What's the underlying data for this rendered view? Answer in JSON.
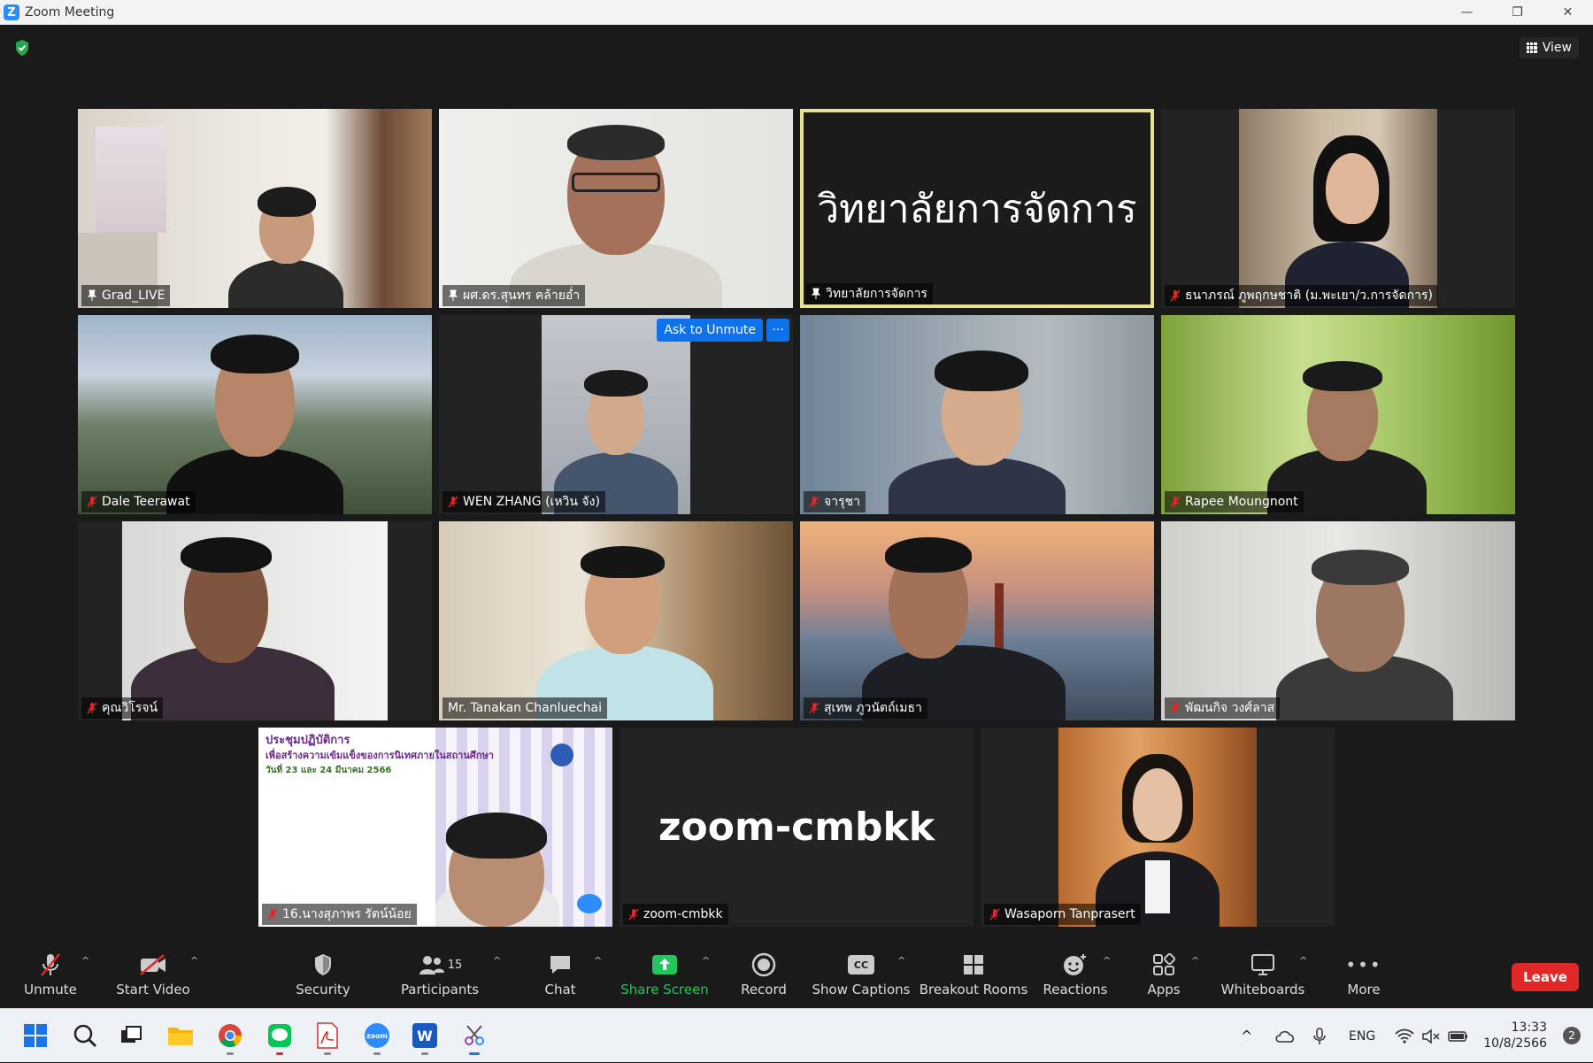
{
  "window": {
    "title": "Zoom Meeting",
    "minimize": "—",
    "restore": "❐",
    "close": "✕"
  },
  "header": {
    "view_label": "View"
  },
  "tiles": [
    {
      "name": "Grad_LIVE",
      "indicator": "pin"
    },
    {
      "name": "ผศ.ดร.สุนทร คล้ายอ่ำ",
      "indicator": "pin"
    },
    {
      "name": "วิทยาลัยการจัดการ",
      "indicator": "pin",
      "big_text": "วิทยาลัยการจัดการ",
      "active": true
    },
    {
      "name": "ธนาภรณ์ ภูพฤกษชาติ (ม.พะเยา/ว.การจัดการ)",
      "indicator": "mic-off"
    },
    {
      "name": "Dale Teerawat",
      "indicator": "mic-off"
    },
    {
      "name": "WEN ZHANG (เหวิน จัง)",
      "indicator": "mic-off",
      "ask_unmute": "Ask to Unmute",
      "more": "···"
    },
    {
      "name": "จารุชา",
      "indicator": "mic-off"
    },
    {
      "name": "Rapee Moungnont",
      "indicator": "mic-off"
    },
    {
      "name": "คุณวิโรจน์",
      "indicator": "mic-off"
    },
    {
      "name": "Mr. Tanakan Chanluechai",
      "indicator": "none"
    },
    {
      "name": "สุเทพ ภูวนัตถ์เมธา",
      "indicator": "mic-off"
    },
    {
      "name": "พัฒนกิจ วงศ์ลาส",
      "indicator": "mic-off"
    },
    {
      "name": "16.นางสุภาพร รัตน์น้อย",
      "indicator": "mic-off",
      "slide_title": "ประชุมปฏิบัติการ",
      "slide_subtitle": "เพื่อสร้างความเข้มแข็งของการนิเทศภายในสถานศึกษา",
      "slide_date": "วันที่ 23 และ 24 มีนาคม 2566"
    },
    {
      "name": "zoom-cmbkk",
      "indicator": "mic-off",
      "big_text": "zoom-cmbkk"
    },
    {
      "name": "Wasaporn Tanprasert",
      "indicator": "mic-off"
    }
  ],
  "toolbar": {
    "unmute": "Unmute",
    "start_video": "Start Video",
    "security": "Security",
    "participants": "Participants",
    "participants_count": "15",
    "chat": "Chat",
    "share_screen": "Share Screen",
    "record": "Record",
    "show_captions": "Show Captions",
    "captions_badge": "CC",
    "breakout_rooms": "Breakout Rooms",
    "reactions": "Reactions",
    "apps": "Apps",
    "whiteboards": "Whiteboards",
    "more": "More",
    "more_glyph": "•••",
    "leave": "Leave",
    "caret": "^"
  },
  "taskbar": {
    "tray_lang": "ENG",
    "tray_caret": "^",
    "time": "13:33",
    "date": "10/8/2566",
    "notifications": "2",
    "zoom_app_label": "zoom",
    "word_app_label": "W"
  },
  "colors": {
    "accent": "#0e72ed",
    "active_border": "#e6e38c",
    "leave": "#e02828",
    "share": "#22c55e"
  }
}
